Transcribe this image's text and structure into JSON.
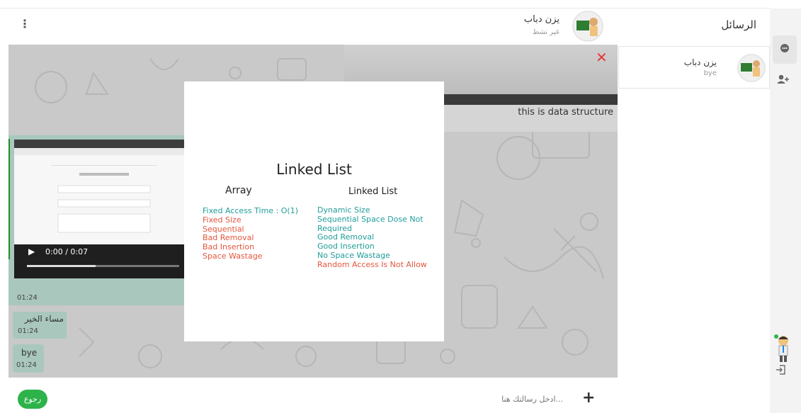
{
  "header": {
    "menu_icon": "⋮",
    "contact_name": "يزن دباب",
    "contact_status": "غير نشط",
    "title": "الرسائل"
  },
  "sidebar": {
    "conversations": [
      {
        "name": "يزن دباب",
        "last_message": "bye"
      }
    ],
    "rail_icons": [
      "chat-icon",
      "add-user-icon"
    ]
  },
  "chat": {
    "image_message": {
      "caption": "this is data structure",
      "close": "✕"
    },
    "video_message": {
      "time_display": "0:00 / 0:07",
      "progress": 0.45,
      "timestamp": "01:24"
    },
    "messages": [
      {
        "text": "مساء الخير",
        "time": "01:24"
      },
      {
        "text": "bye",
        "time": "01:24"
      }
    ]
  },
  "modal": {
    "title": "Linked List",
    "columns": [
      {
        "heading": "Array",
        "items": [
          {
            "text": "Fixed Access Time : O(1)",
            "color": "#1f9d9a"
          },
          {
            "text": "Fixed Size",
            "color": "#e5553d"
          },
          {
            "text": "Sequential",
            "color": "#e5553d"
          },
          {
            "text": "Bad Removal",
            "color": "#e5553d"
          },
          {
            "text": "Bad Insertion",
            "color": "#e5553d"
          },
          {
            "text": "Space Wastage",
            "color": "#e5553d"
          }
        ]
      },
      {
        "heading": "Linked List",
        "items": [
          {
            "text": "Dynamic Size",
            "color": "#1f9d9a"
          },
          {
            "text": "Sequential Space Dose Not Required",
            "color": "#1f9d9a"
          },
          {
            "text": "Good Removal",
            "color": "#1f9d9a"
          },
          {
            "text": "Good Insertion",
            "color": "#1f9d9a"
          },
          {
            "text": "No Space Wastage",
            "color": "#1f9d9a"
          },
          {
            "text": "Random Access Is Not Allow",
            "color": "#e5553d"
          }
        ]
      }
    ]
  },
  "composer": {
    "back_label": "رجوع",
    "placeholder": "ادخل رسالتك هنا...",
    "send_icon": "+"
  },
  "colors": {
    "accent": "#2db34a",
    "bubble": "#a9c7bd",
    "teal": "#1f9d9a",
    "red": "#e5553d"
  }
}
